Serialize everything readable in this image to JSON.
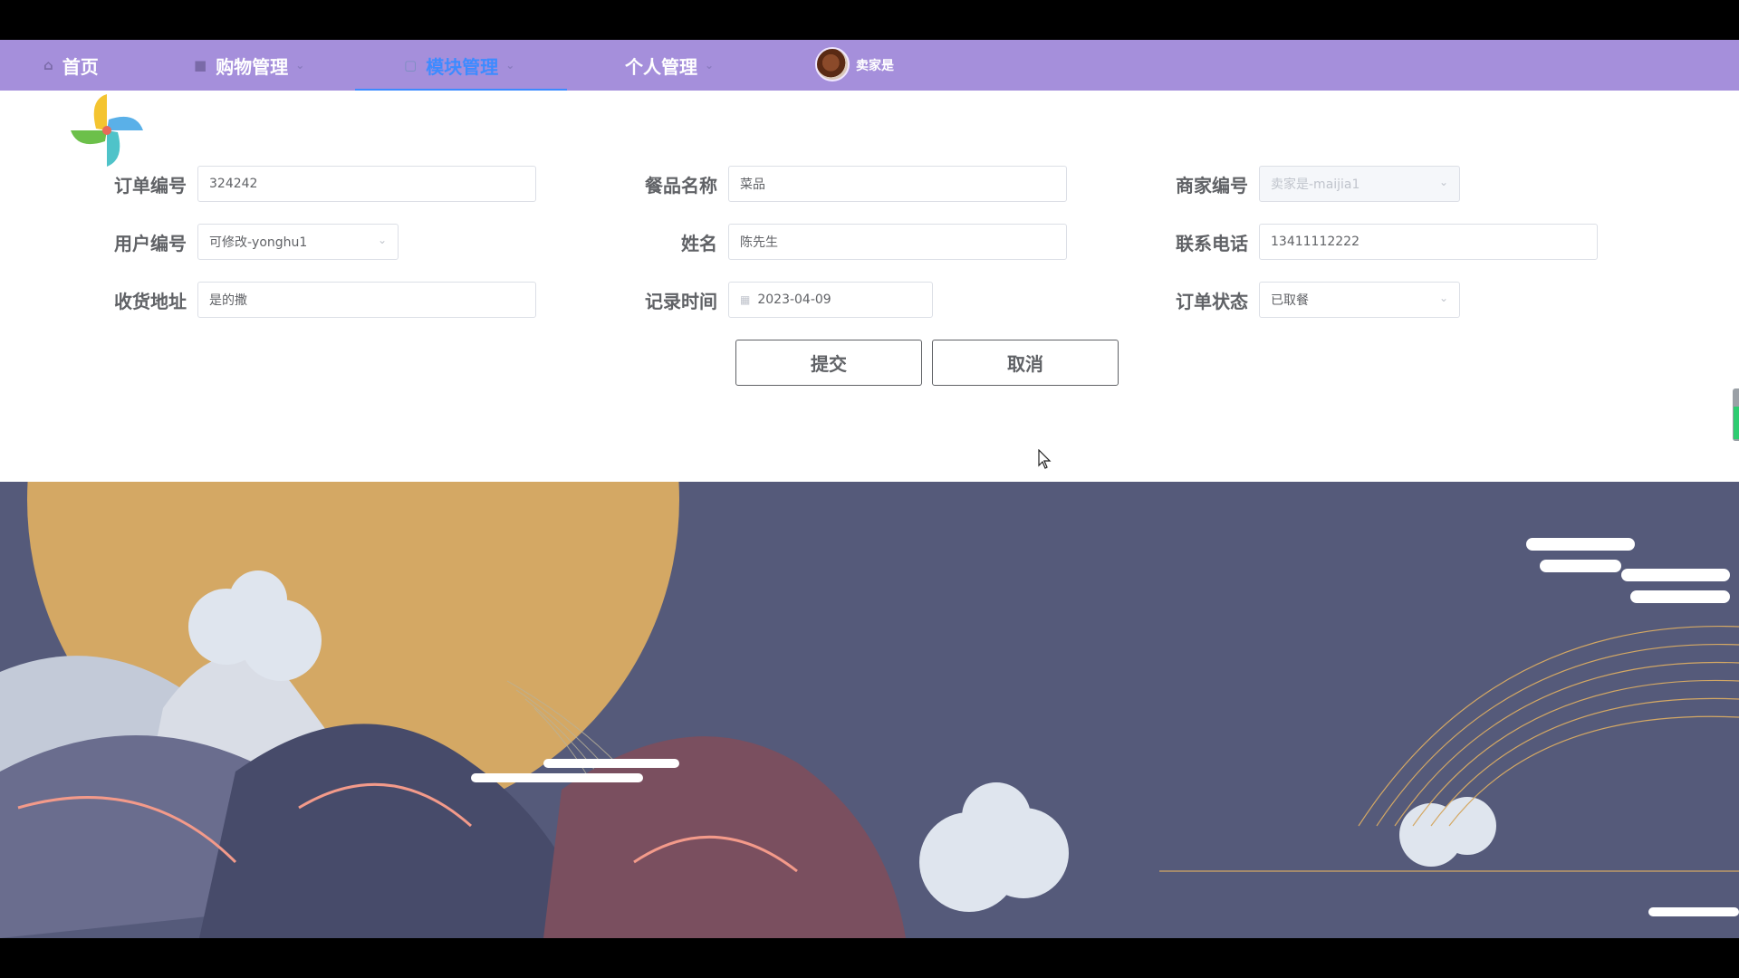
{
  "nav": {
    "items": [
      {
        "label": "首页",
        "icon": "home-icon"
      },
      {
        "label": "购物管理",
        "icon": "lock-icon"
      },
      {
        "label": "模块管理",
        "icon": "module-icon",
        "active": true
      },
      {
        "label": "个人管理",
        "icon": ""
      }
    ],
    "username": "卖家是"
  },
  "form": {
    "order_no": {
      "label": "订单编号",
      "value": "324242"
    },
    "dish_name": {
      "label": "餐品名称",
      "value": "菜品"
    },
    "merchant_no": {
      "label": "商家编号",
      "value": "卖家是-maijia1",
      "disabled": true
    },
    "user_no": {
      "label": "用户编号",
      "value": "可修改-yonghu1"
    },
    "name": {
      "label": "姓名",
      "value": "陈先生"
    },
    "phone": {
      "label": "联系电话",
      "value": "13411112222"
    },
    "address": {
      "label": "收货地址",
      "value": "是的撒"
    },
    "record_time": {
      "label": "记录时间",
      "value": "2023-04-09"
    },
    "order_status": {
      "label": "订单状态",
      "value": "已取餐"
    }
  },
  "buttons": {
    "submit": "提交",
    "cancel": "取消"
  },
  "colors": {
    "nav_bg": "#a58fdb",
    "accent": "#3d8bff",
    "banner_bg": "#555a7a",
    "sun": "#d4a864"
  }
}
